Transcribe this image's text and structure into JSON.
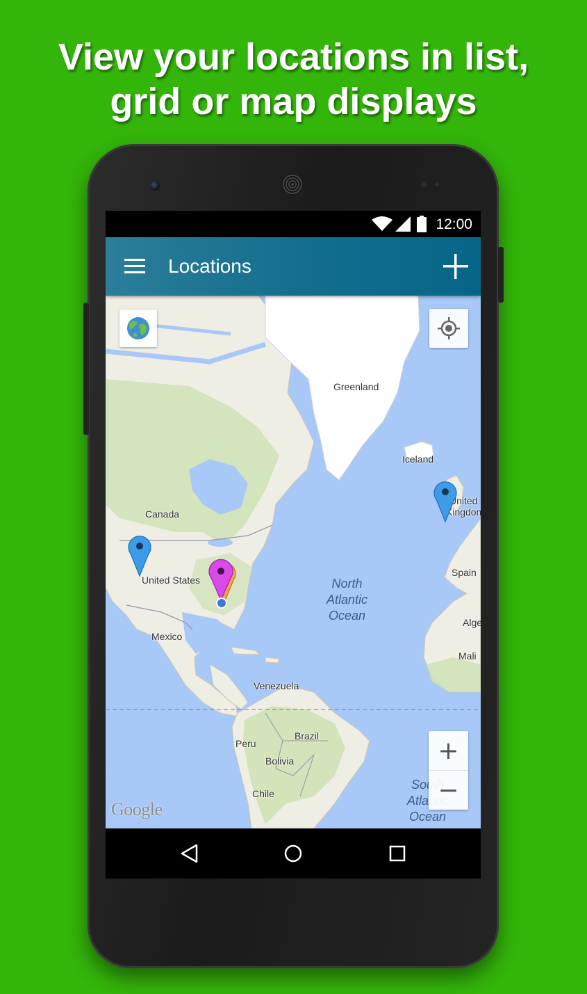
{
  "headline": {
    "line1": "View your locations in list,",
    "line2": "grid or map displays"
  },
  "status_bar": {
    "time": "12:00",
    "icons": [
      "wifi-icon",
      "cell-signal-icon",
      "battery-icon"
    ]
  },
  "app_bar": {
    "title": "Locations",
    "menu_icon": "hamburger-menu-icon",
    "action_icon": "add-icon",
    "color_start": "#2c7e99",
    "color_end": "#066587"
  },
  "map": {
    "labels": {
      "greenland": "Greenland",
      "iceland": "Iceland",
      "united_kingdom_line1": "United",
      "united_kingdom_line2": "Kingdom",
      "canada": "Canada",
      "united_states": "United States",
      "mexico": "Mexico",
      "spain": "Spain",
      "algeria": "Alge",
      "mali": "Mali",
      "venezuela": "Venezuela",
      "brazil": "Brazil",
      "peru": "Peru",
      "bolivia": "Bolivia",
      "chile": "Chile"
    },
    "ocean_labels": {
      "north_atlantic": [
        "North",
        "Atlantic",
        "Ocean"
      ],
      "south_atlantic": [
        "South",
        "Atlantic",
        "Ocean"
      ]
    },
    "attribution": "Google",
    "controls": {
      "layer_icon": "globe-icon",
      "locate_icon": "my-location-icon",
      "zoom_in": "+",
      "zoom_out": "−"
    },
    "pins": [
      {
        "name": "pin-western-us",
        "color": "#3d9be9"
      },
      {
        "name": "pin-united-kingdom",
        "color": "#3d9be9"
      },
      {
        "name": "pin-southeast-us",
        "color": "#d94ae8"
      }
    ],
    "colors": {
      "water": "#a8c8f8",
      "land": "#efeee5",
      "vegetation": "#cfe2b5",
      "ice": "#ffffff"
    }
  },
  "nav_bar": {
    "icons": [
      "back-icon",
      "home-icon",
      "recents-icon"
    ]
  }
}
